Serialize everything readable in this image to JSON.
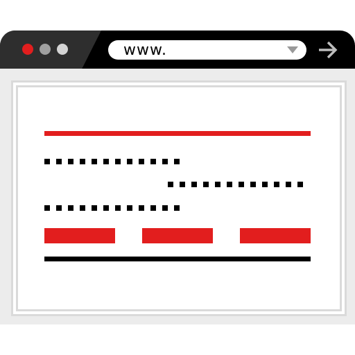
{
  "browser": {
    "window_dots": [
      {
        "name": "close",
        "color": "#e21e1e"
      },
      {
        "name": "minimize",
        "color": "#a0a0a0"
      },
      {
        "name": "maximize",
        "color": "#d4d4d4"
      }
    ],
    "address_bar": {
      "text": "www.",
      "dropdown_icon": "chevron-down-icon"
    },
    "go_icon": "arrow-right-icon"
  },
  "colors": {
    "accent": "#e21e1e",
    "dark": "#000000",
    "titlebar_left": "#2e2e2e",
    "frame": "#ececec",
    "border": "#dadada"
  }
}
